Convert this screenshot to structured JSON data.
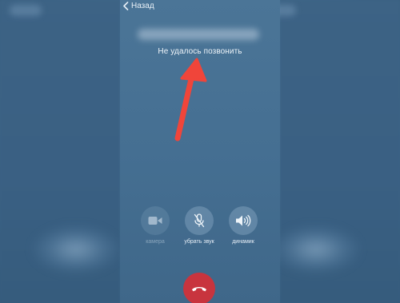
{
  "header": {
    "back_label": "Назад"
  },
  "call": {
    "status_text": "Не удалось позвонить"
  },
  "controls": [
    {
      "label": "камера",
      "icon": "video-camera-icon",
      "enabled": false
    },
    {
      "label": "убрать звук",
      "icon": "microphone-mute-icon",
      "enabled": true
    },
    {
      "label": "динамик",
      "icon": "speaker-icon",
      "enabled": true
    }
  ],
  "end_call": {
    "icon": "phone-hangup-icon",
    "color": "#c8343e"
  },
  "annotation": {
    "icon": "red-arrow-icon",
    "color": "#f0453a"
  },
  "theme": {
    "background": "#416a8c",
    "text": "#eef4f9"
  }
}
